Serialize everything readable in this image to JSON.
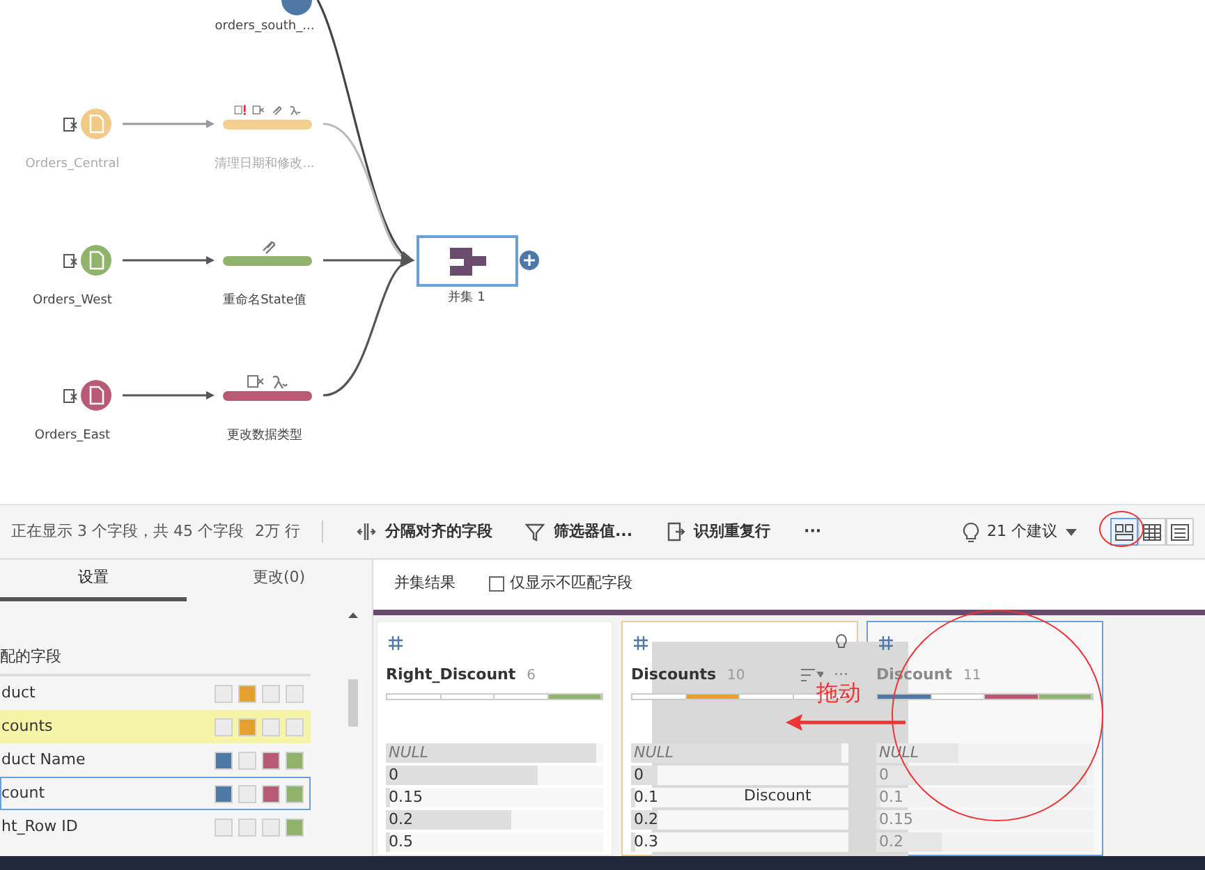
{
  "flow": {
    "branches": [
      {
        "kind": "clipped",
        "step": {
          "label": "orders_south_...",
          "color": "#4e79a7"
        }
      },
      {
        "kind": "full",
        "disabled": true,
        "input": {
          "label": "Orders_Central",
          "color": "#f2c987"
        },
        "step": {
          "label": "清理日期和修改...",
          "color": "#f2cf8f",
          "changes": [
            {
              "kind": "warning"
            },
            {
              "kind": "filter"
            },
            {
              "kind": "rename"
            },
            {
              "kind": "type"
            }
          ]
        }
      },
      {
        "kind": "full",
        "disabled": false,
        "input": {
          "label": "Orders_West",
          "color": "#8fb36a"
        },
        "step": {
          "label": "重命名State值",
          "color": "#8fb36a",
          "changes": [
            {
              "kind": "rename"
            }
          ]
        }
      },
      {
        "kind": "full",
        "disabled": false,
        "input": {
          "label": "Orders_East",
          "color": "#b85a75"
        },
        "step": {
          "label": "更改数据类型",
          "color": "#b85a75",
          "changes": [
            {
              "kind": "filter"
            },
            {
              "kind": "type"
            }
          ]
        }
      }
    ],
    "union": {
      "label": "并集 1",
      "selected": true
    }
  },
  "toolbar": {
    "summary": "正在显示 3 个字段，共 45 个字段",
    "rows": "2万 行",
    "actions": [
      {
        "kind": "split",
        "label": "分隔对齐的字段"
      },
      {
        "kind": "filter",
        "label": "筛选器值..."
      },
      {
        "kind": "dedupe",
        "label": "识别重复行"
      },
      {
        "kind": "more",
        "label": "···"
      }
    ],
    "suggestions": "21 个建议",
    "views": [
      {
        "kind": "profile",
        "selected": true
      },
      {
        "kind": "grid",
        "selected": false
      },
      {
        "kind": "list",
        "selected": false
      }
    ]
  },
  "settings": {
    "tabs": [
      {
        "label": "设置",
        "selected": true
      },
      {
        "label": "更改(0)",
        "selected": false
      }
    ],
    "header": "配的字段",
    "fields": [
      {
        "name": "duct",
        "highlighted": false,
        "selected": false,
        "inputs": [
          {
            "color": "#ececec"
          },
          {
            "color": "#e5a030"
          },
          {
            "color": "#ececec"
          },
          {
            "color": "#ececec"
          }
        ]
      },
      {
        "name": "counts",
        "highlighted": true,
        "selected": false,
        "inputs": [
          {
            "color": "#ececec"
          },
          {
            "color": "#e5a030"
          },
          {
            "color": "#ececec"
          },
          {
            "color": "#ececec"
          }
        ]
      },
      {
        "name": "duct Name",
        "highlighted": false,
        "selected": false,
        "inputs": [
          {
            "color": "#4e79a7"
          },
          {
            "color": "#ececec"
          },
          {
            "color": "#b85a75"
          },
          {
            "color": "#8fb36a"
          }
        ]
      },
      {
        "name": "count",
        "highlighted": false,
        "selected": true,
        "inputs": [
          {
            "color": "#4e79a7"
          },
          {
            "color": "#ececec"
          },
          {
            "color": "#b85a75"
          },
          {
            "color": "#8fb36a"
          }
        ]
      },
      {
        "name": "ht_Row ID",
        "highlighted": false,
        "selected": false,
        "inputs": [
          {
            "color": "#ececec"
          },
          {
            "color": "#ececec"
          },
          {
            "color": "#ececec"
          },
          {
            "color": "#8fb36a"
          }
        ]
      }
    ]
  },
  "results": {
    "title": "并集结果",
    "mismatch_only": {
      "label": "仅显示不匹配字段",
      "checked": false
    },
    "cards": [
      {
        "kind": "normal",
        "title": "Right_Discount",
        "count": "6",
        "segments": [
          {
            "color": "#ffffff"
          },
          {
            "color": "#ffffff"
          },
          {
            "color": "#ffffff"
          },
          {
            "color": "#8fb36a"
          }
        ],
        "values": [
          {
            "label": "NULL",
            "null": true,
            "level": 0.97
          },
          {
            "label": "0",
            "null": false,
            "level": 0.7
          },
          {
            "label": "0.15",
            "null": false,
            "level": 0.02
          },
          {
            "label": "0.2",
            "null": false,
            "level": 0.58
          },
          {
            "label": "0.5",
            "null": false,
            "level": 0.02
          }
        ]
      },
      {
        "kind": "target",
        "title": "Discounts",
        "count": "10",
        "more": "···",
        "segments": [
          {
            "color": "#ffffff"
          },
          {
            "color": "#e5a030"
          },
          {
            "color": "#ffffff"
          },
          {
            "color": "#ffffff"
          }
        ],
        "values": [
          {
            "label": "NULL",
            "null": true,
            "level": 0.97
          },
          {
            "label": "0",
            "null": false,
            "level": 0.12
          },
          {
            "label": "0.1",
            "null": false,
            "level": 0.02
          },
          {
            "label": "0.2",
            "null": false,
            "level": 0.12
          },
          {
            "label": "0.3",
            "null": false,
            "level": 0.02
          }
        ]
      },
      {
        "kind": "source",
        "title": "Discount",
        "count": "11",
        "segments": [
          {
            "color": "#4e79a7"
          },
          {
            "color": "#ffffff"
          },
          {
            "color": "#b85a75"
          },
          {
            "color": "#8fb36a"
          }
        ],
        "values": [
          {
            "label": "NULL",
            "null": true,
            "level": 0.38
          },
          {
            "label": "0",
            "null": false,
            "level": 0.97
          },
          {
            "label": "0.1",
            "null": false,
            "level": 0.02
          },
          {
            "label": "0.15",
            "null": false,
            "level": 0.02
          },
          {
            "label": "0.2",
            "null": false,
            "level": 0.3
          }
        ]
      }
    ],
    "drag_ghost": {
      "label": "Discount"
    },
    "annotation": {
      "text": "拖动"
    }
  }
}
